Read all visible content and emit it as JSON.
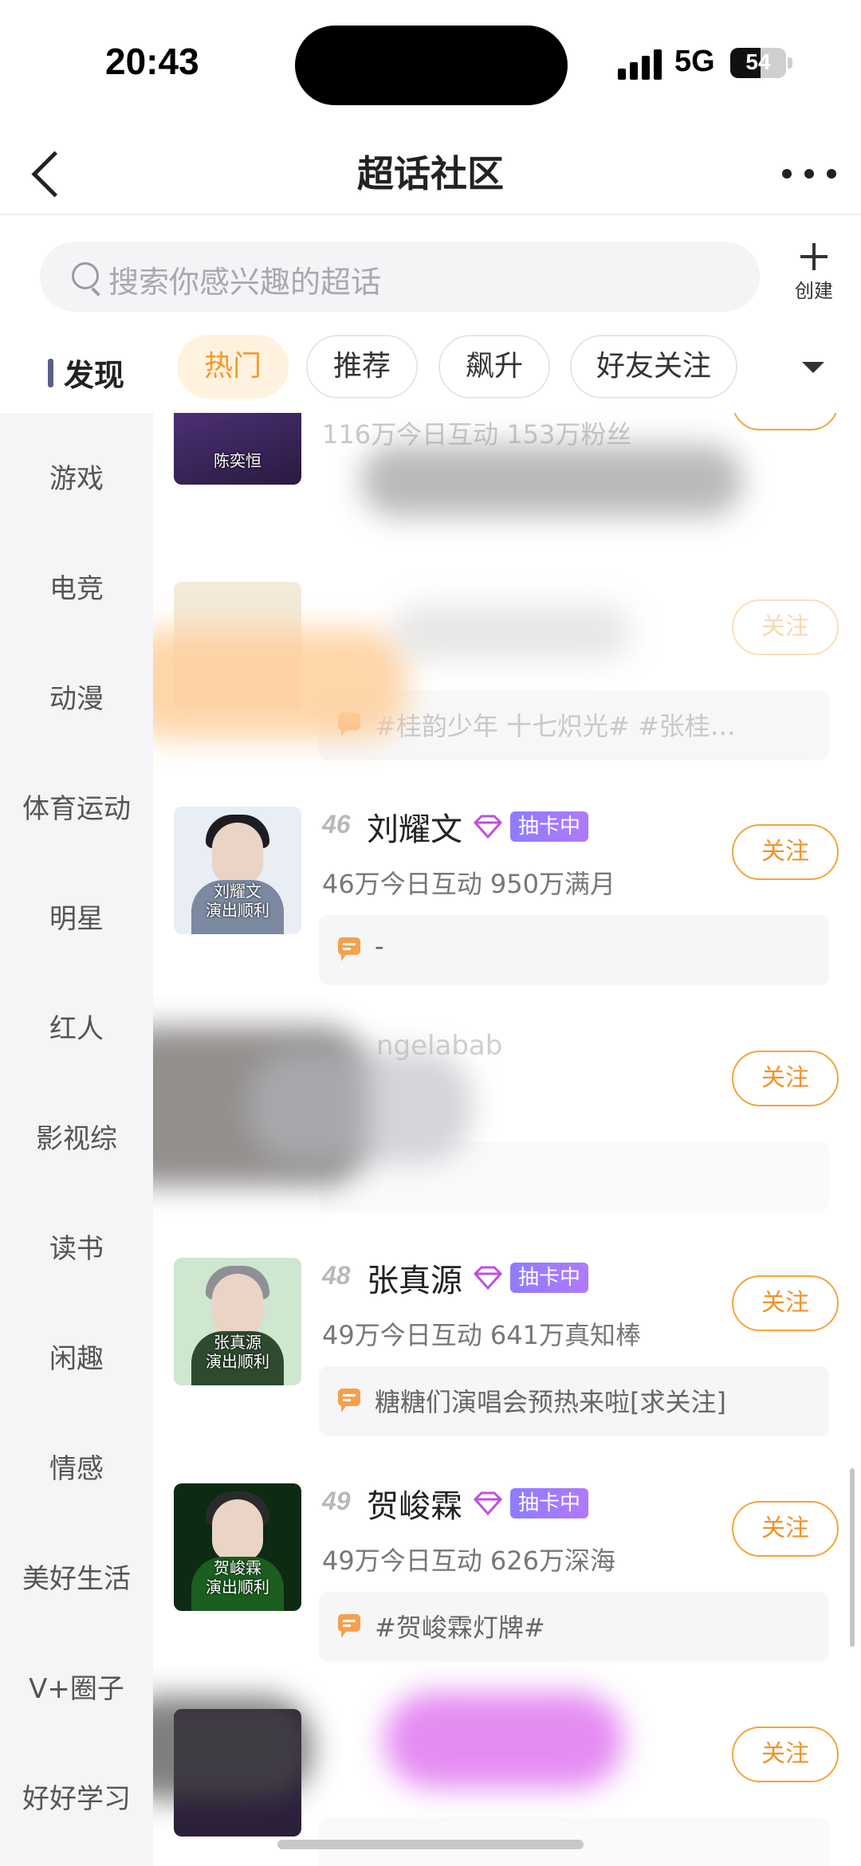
{
  "status_bar": {
    "time": "20:43",
    "network": "5G",
    "battery": "54",
    "battery_level": 0.54
  },
  "nav": {
    "title": "超话社区"
  },
  "search": {
    "placeholder": "搜索你感兴趣的超话",
    "create_label": "创建"
  },
  "tabs": {
    "discover": "发现",
    "chips": [
      "热门",
      "推荐",
      "飙升",
      "好友关注"
    ],
    "active": "热门"
  },
  "sidebar": {
    "items": [
      "游戏",
      "电竞",
      "动漫",
      "体育运动",
      "明星",
      "红人",
      "影视综",
      "读书",
      "闲趣",
      "情感",
      "美好生活",
      "V+圈子",
      "好好学习"
    ]
  },
  "cards": [
    {
      "rank": "46",
      "name": "刘耀文",
      "badge": "抽卡中",
      "stats": "46万今日互动 950万满月",
      "follow": "关注",
      "post": "-",
      "cover_text": "刘耀文\n演出顺利",
      "cover_colors": [
        "#7b8aa0",
        "#1c1c22",
        "#e9eef4"
      ],
      "icon": "diamond-icon"
    },
    {
      "rank": "48",
      "name": "张真源",
      "badge": "抽卡中",
      "stats": "49万今日互动 641万真知棒",
      "follow": "关注",
      "post": "糖糖们演唱会预热来啦[求关注]",
      "cover_text": "张真源\n演出顺利",
      "cover_colors": [
        "#7fbf85",
        "#8f8f96",
        "#2e4a2f"
      ],
      "icon": "diamond-icon"
    },
    {
      "rank": "49",
      "name": "贺峻霖",
      "badge": "抽卡中",
      "stats": "49万今日互动 626万深海",
      "follow": "关注",
      "post": "#贺峻霖灯牌#",
      "cover_text": "贺峻霖\n演出顺利",
      "cover_colors": [
        "#0d2a12",
        "#2a2a2a",
        "#1b5e20"
      ],
      "icon": "diamond-icon"
    }
  ],
  "partial_cards": {
    "top_stats": "116万今日互动 153万粉丝",
    "top_cover_text": "陈奕恒",
    "second_post": "#桂韵少年 十七炽光# #张桂…",
    "third_name_fragment": "ngelabab",
    "follow": "关注"
  },
  "colors": {
    "accent_orange": "#f29a2e",
    "badge_purple": "#9b7bff",
    "sidebar_bg": "#f5f5f8"
  }
}
